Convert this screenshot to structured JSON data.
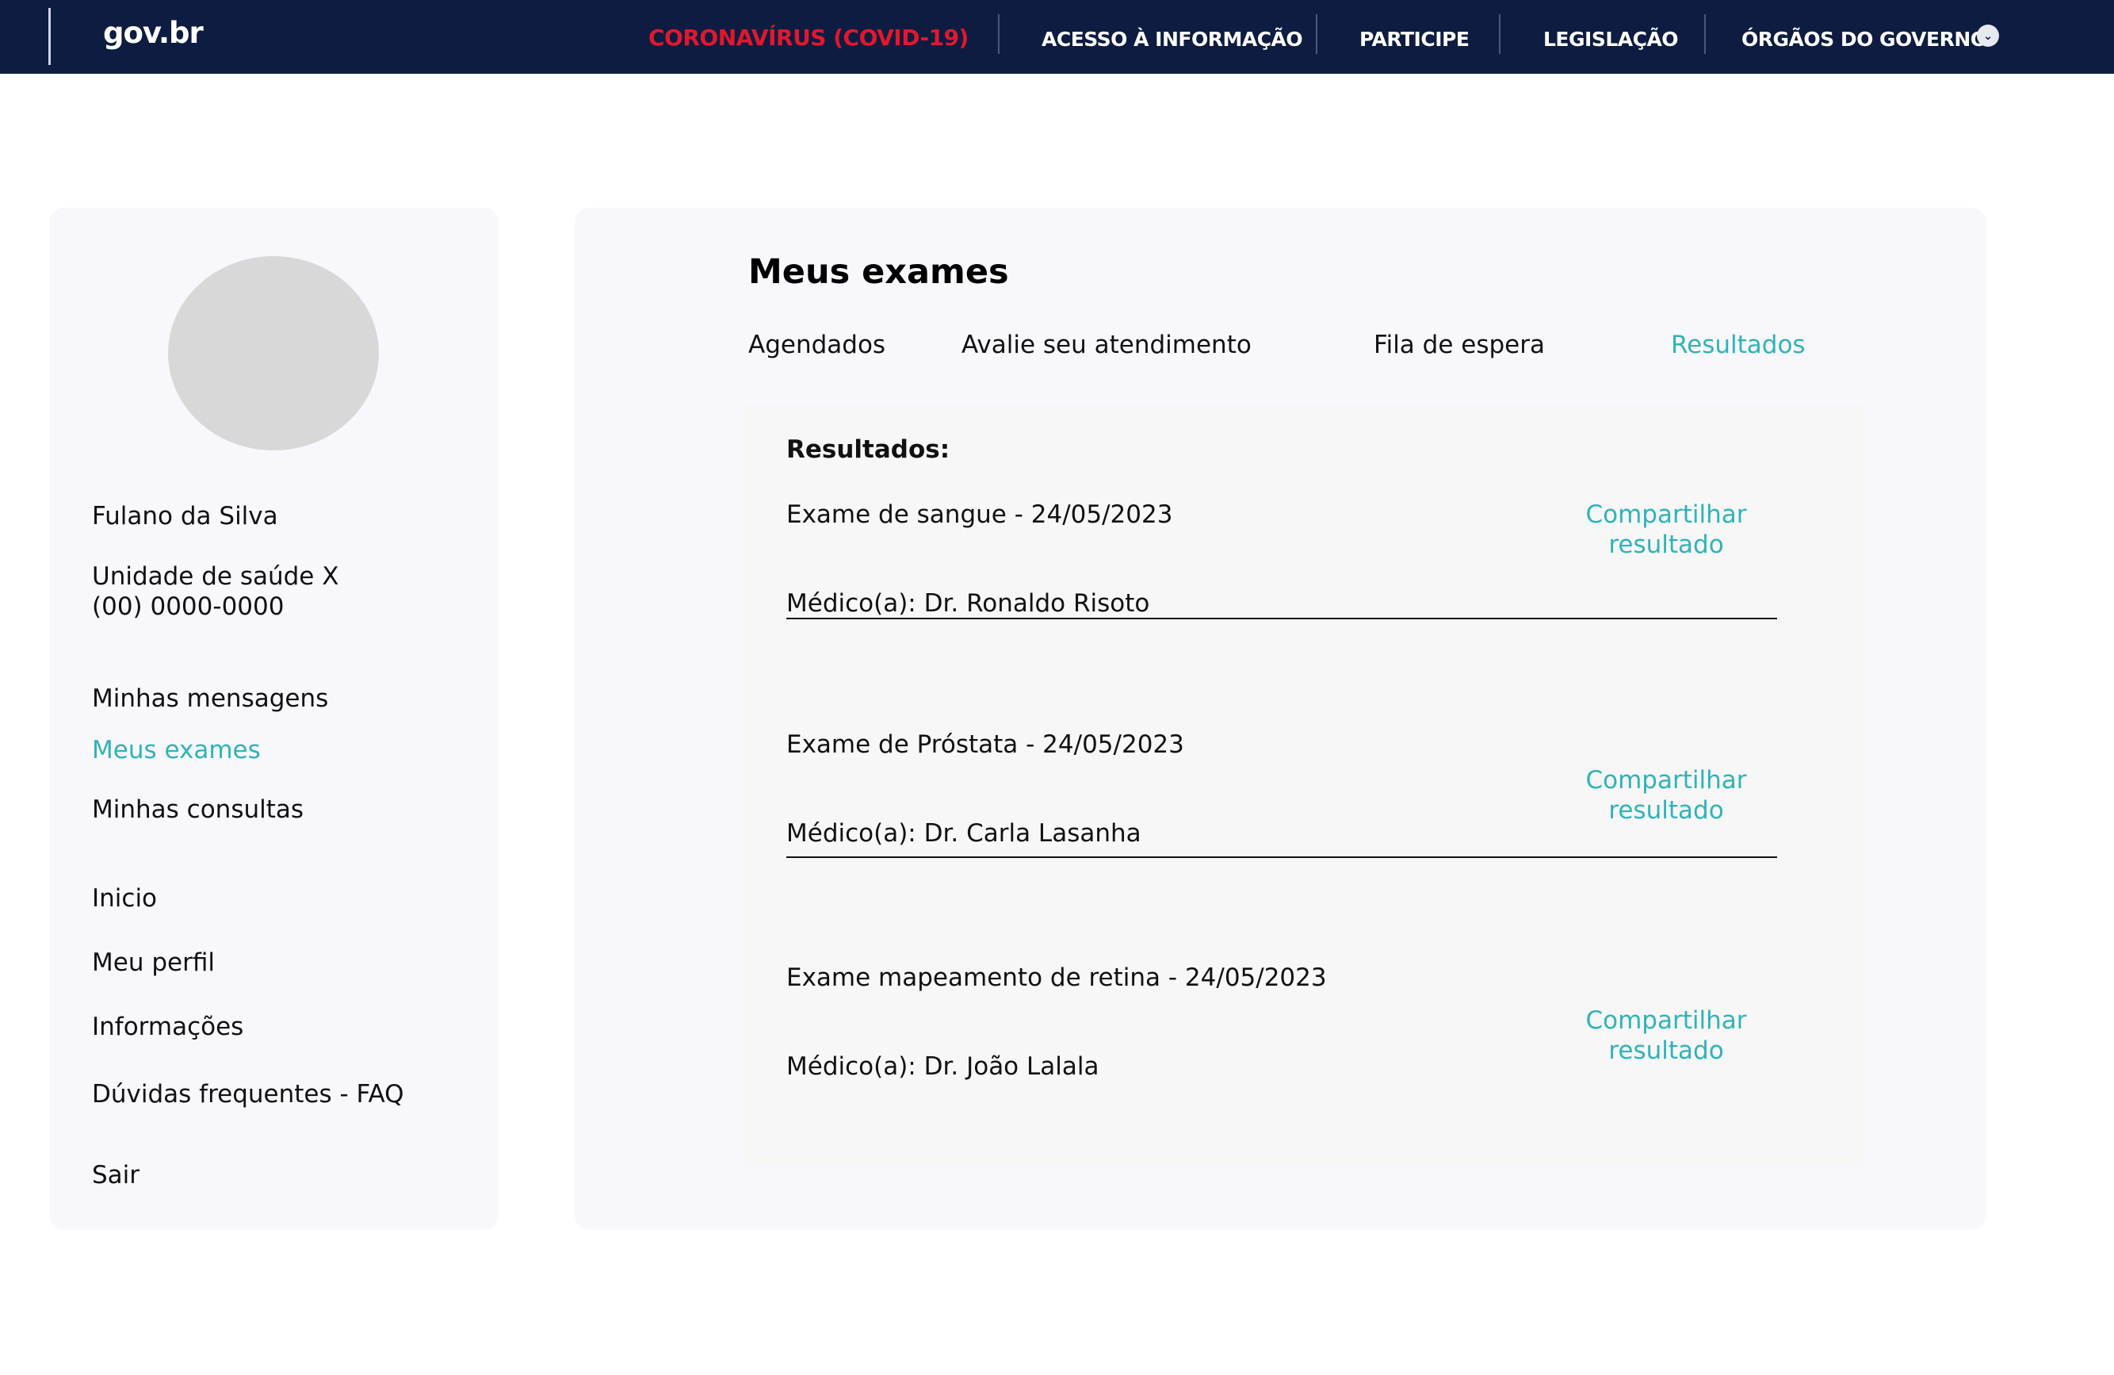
{
  "topbar": {
    "logo": "gov.br",
    "links": [
      "CORONAVÍRUS (COVID-19)",
      "ACESSO À INFORMAÇÃO",
      "PARTICIPE",
      "LEGISLAÇÃO",
      "ÓRGÃOS DO GOVERNO"
    ],
    "dropdown_icon": "chevron-down-icon",
    "covid_color": "#e0182d",
    "bar_color": "#0e1c41"
  },
  "sidebar": {
    "user_name": "Fulano da Silva",
    "unit_name": "Unidade de saúde X",
    "unit_phone": "(00) 0000-0000",
    "menu": [
      "Minhas mensagens",
      "Meus exames",
      "Minhas consultas",
      "Inicio",
      "Meu perfil",
      "Informações",
      "Dúvidas frequentes - FAQ",
      "Sair"
    ],
    "active_item": "Meus exames"
  },
  "main": {
    "title": "Meus exames",
    "tabs": [
      "Agendados",
      "Avalie seu atendimento",
      "Fila de espera",
      "Resultados"
    ],
    "active_tab": "Resultados",
    "results": {
      "heading": "Resultados:",
      "share_line1": "Compartilhar",
      "share_line2": "resultado",
      "exams": [
        {
          "name": "Exame de sangue - 24/05/2023",
          "doctor": "Médico(a): Dr. Ronaldo Risoto"
        },
        {
          "name": "Exame de Próstata  - 24/05/2023",
          "doctor": "Médico(a): Dr. Carla Lasanha"
        },
        {
          "name": "Exame mapeamento de retina - 24/05/2023",
          "doctor": "Médico(a): Dr. João Lalala"
        }
      ]
    }
  },
  "accent_color": "#2fb3b8"
}
